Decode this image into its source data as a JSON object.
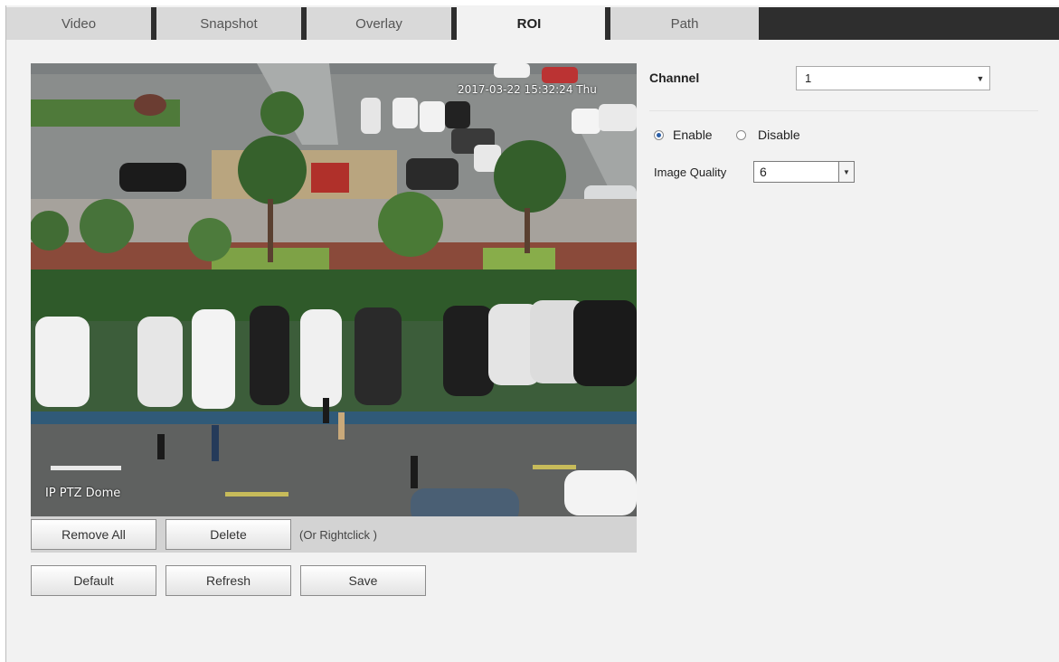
{
  "tabs": [
    {
      "label": "Video"
    },
    {
      "label": "Snapshot"
    },
    {
      "label": "Overlay"
    },
    {
      "label": "ROI"
    },
    {
      "label": "Path"
    }
  ],
  "video": {
    "timestamp": "2017-03-22 15:32:24 Thu",
    "camera_name": "IP PTZ Dome"
  },
  "actions": {
    "remove_all": "Remove All",
    "delete": "Delete",
    "hint": "(Or Rightclick )",
    "default": "Default",
    "refresh": "Refresh",
    "save": "Save"
  },
  "settings": {
    "channel_label": "Channel",
    "channel_value": "1",
    "enable_label": "Enable",
    "disable_label": "Disable",
    "enabled": true,
    "quality_label": "Image Quality",
    "quality_value": "6"
  }
}
